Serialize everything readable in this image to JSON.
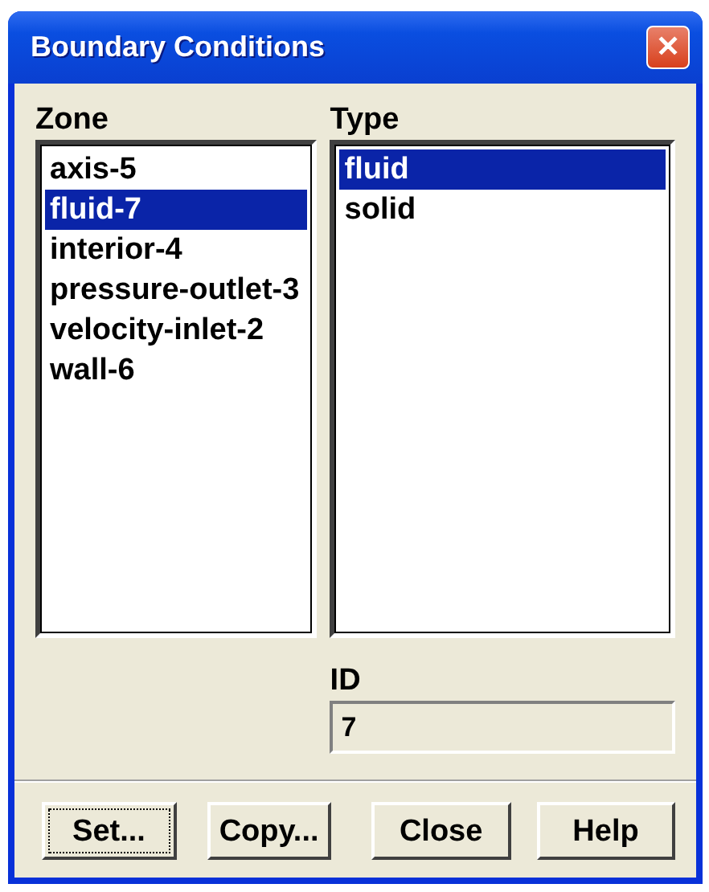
{
  "window": {
    "title": "Boundary Conditions",
    "close": "✕"
  },
  "zone": {
    "label": "Zone",
    "items": [
      {
        "label": "axis-5",
        "selected": false
      },
      {
        "label": "fluid-7",
        "selected": true
      },
      {
        "label": "interior-4",
        "selected": false
      },
      {
        "label": "pressure-outlet-3",
        "selected": false
      },
      {
        "label": "velocity-inlet-2",
        "selected": false
      },
      {
        "label": "wall-6",
        "selected": false
      }
    ]
  },
  "type": {
    "label": "Type",
    "items": [
      {
        "label": "fluid",
        "selected": true
      },
      {
        "label": "solid",
        "selected": false
      }
    ]
  },
  "id": {
    "label": "ID",
    "value": "7"
  },
  "buttons": [
    {
      "label": "Set...",
      "focused": true
    },
    {
      "label": "Copy...",
      "focused": false
    },
    {
      "label": "Close",
      "focused": false
    },
    {
      "label": "Help",
      "focused": false
    }
  ]
}
